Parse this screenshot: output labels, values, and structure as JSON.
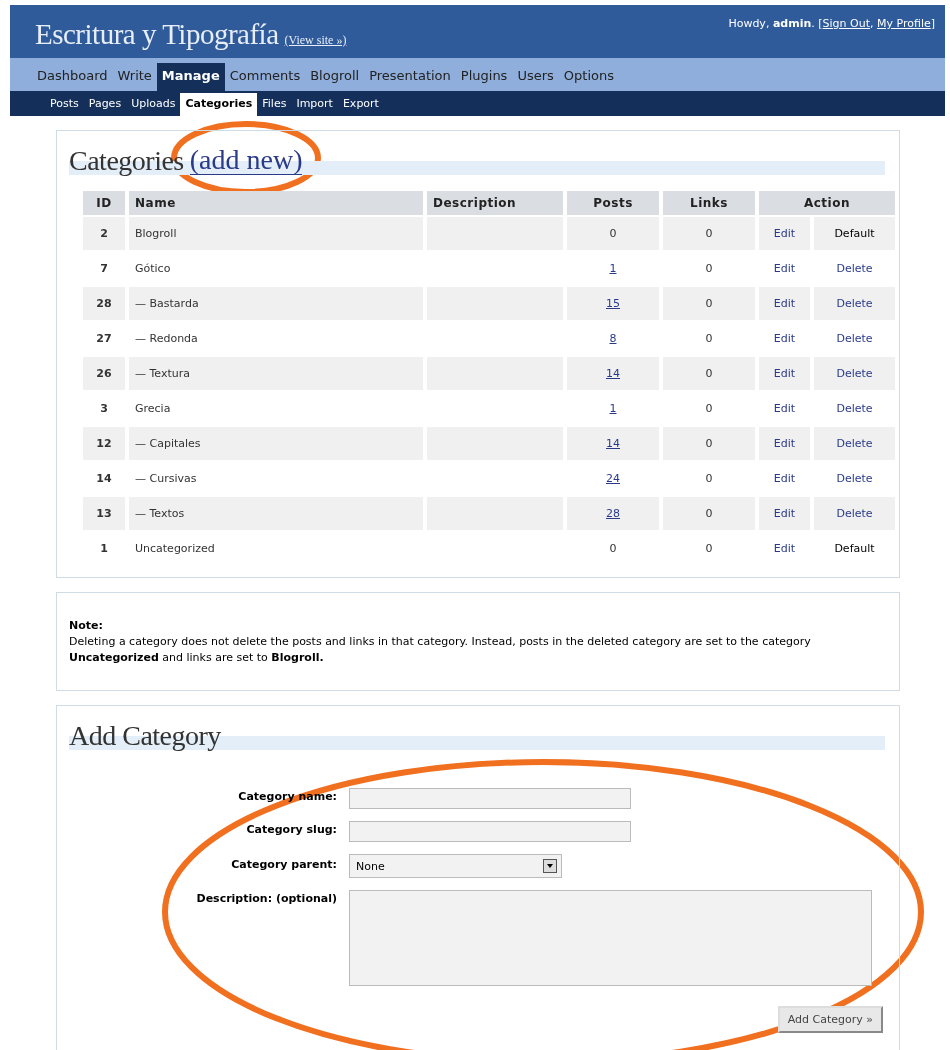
{
  "site": {
    "title": "Escritura y Tipografía",
    "view_site": "(View site »)",
    "greeting": "Howdy,",
    "user": "admin",
    "open": ". [",
    "links": [
      "Sign Out",
      "My Profile"
    ],
    "separator": ",",
    "close": "]"
  },
  "menu": [
    {
      "label": "Dashboard",
      "selected": false
    },
    {
      "label": "Write",
      "selected": false
    },
    {
      "label": "Manage",
      "selected": true
    },
    {
      "label": "Comments",
      "selected": false
    },
    {
      "label": "Blogroll",
      "selected": false
    },
    {
      "label": "Presentation",
      "selected": false
    },
    {
      "label": "Plugins",
      "selected": false
    },
    {
      "label": "Users",
      "selected": false
    },
    {
      "label": "Options",
      "selected": false
    }
  ],
  "submenu": [
    {
      "label": "Posts",
      "selected": false
    },
    {
      "label": "Pages",
      "selected": false
    },
    {
      "label": "Uploads",
      "selected": false
    },
    {
      "label": "Categories",
      "selected": true
    },
    {
      "label": "Files",
      "selected": false
    },
    {
      "label": "Import",
      "selected": false
    },
    {
      "label": "Export",
      "selected": false
    }
  ],
  "categories": {
    "title": "Categories",
    "add_new": "(add new)",
    "columns": [
      "ID",
      "Name",
      "Description",
      "Posts",
      "Links",
      "Action"
    ],
    "rows": [
      {
        "id": "2",
        "name": "Blogroll",
        "posts": "0",
        "posts_link": false,
        "links": "0",
        "edit": "Edit",
        "action": "Default",
        "action_link": false
      },
      {
        "id": "7",
        "name": "Gótico",
        "posts": "1",
        "posts_link": true,
        "links": "0",
        "edit": "Edit",
        "action": "Delete",
        "action_link": true
      },
      {
        "id": "28",
        "name": "— Bastarda",
        "posts": "15",
        "posts_link": true,
        "links": "0",
        "edit": "Edit",
        "action": "Delete",
        "action_link": true
      },
      {
        "id": "27",
        "name": "— Redonda",
        "posts": "8",
        "posts_link": true,
        "links": "0",
        "edit": "Edit",
        "action": "Delete",
        "action_link": true
      },
      {
        "id": "26",
        "name": "— Textura",
        "posts": "14",
        "posts_link": true,
        "links": "0",
        "edit": "Edit",
        "action": "Delete",
        "action_link": true
      },
      {
        "id": "3",
        "name": "Grecia",
        "posts": "1",
        "posts_link": true,
        "links": "0",
        "edit": "Edit",
        "action": "Delete",
        "action_link": true
      },
      {
        "id": "12",
        "name": "— Capitales",
        "posts": "14",
        "posts_link": true,
        "links": "0",
        "edit": "Edit",
        "action": "Delete",
        "action_link": true
      },
      {
        "id": "14",
        "name": "— Cursivas",
        "posts": "24",
        "posts_link": true,
        "links": "0",
        "edit": "Edit",
        "action": "Delete",
        "action_link": true
      },
      {
        "id": "13",
        "name": "— Textos",
        "posts": "28",
        "posts_link": true,
        "links": "0",
        "edit": "Edit",
        "action": "Delete",
        "action_link": true
      },
      {
        "id": "1",
        "name": "Uncategorized",
        "posts": "0",
        "posts_link": false,
        "links": "0",
        "edit": "Edit",
        "action": "Default",
        "action_link": false
      }
    ]
  },
  "note": {
    "heading": "Note:",
    "text": "Deleting a category does not delete the posts and links in that category. Instead, posts in the deleted category are set to the category **Uncategorized** and links are set to **Blogroll.**"
  },
  "add_category": {
    "title": "Add Category",
    "fields": [
      {
        "kind": "text",
        "label": "Category name:"
      },
      {
        "kind": "text",
        "label": "Category slug:"
      },
      {
        "kind": "select",
        "label": "Category parent:",
        "value": "None"
      },
      {
        "kind": "textarea",
        "label": "Description: (optional)"
      }
    ],
    "button": "Add Category »"
  },
  "annotations": [
    {
      "kind": "ellipse"
    },
    {
      "kind": "ellipse"
    }
  ]
}
